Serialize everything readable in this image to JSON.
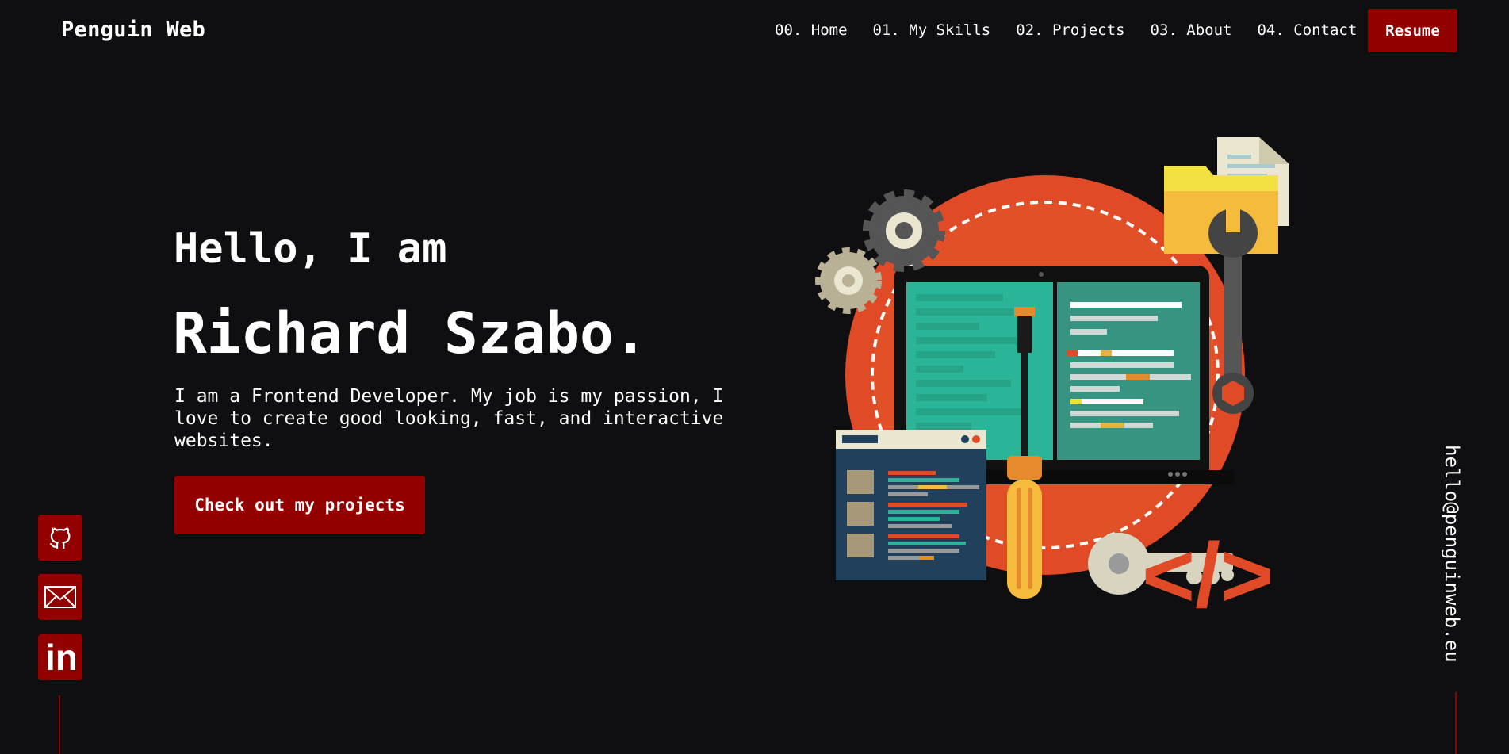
{
  "brand": "Penguin Web",
  "nav": {
    "items": [
      "00. Home",
      "01. My Skills",
      "02. Projects",
      "03. About",
      "04. Contact"
    ],
    "resume_label": "Resume"
  },
  "hero": {
    "greeting": "Hello, I am",
    "name": "Richard Szabo.",
    "intro": "I am a Frontend Developer. My job is my passion, I love to create good looking, fast, and interactive websites.",
    "cta_label": "Check out my projects",
    "code_symbol": "</>"
  },
  "social": {
    "icons": [
      "github-icon",
      "mail-icon",
      "linkedin-icon"
    ],
    "linkedin_text": "in"
  },
  "email": "hello@penguinweb.eu",
  "colors": {
    "background": "#0f0f11",
    "accent": "#930000",
    "text": "#ffffff",
    "orange": "#e04a26"
  }
}
